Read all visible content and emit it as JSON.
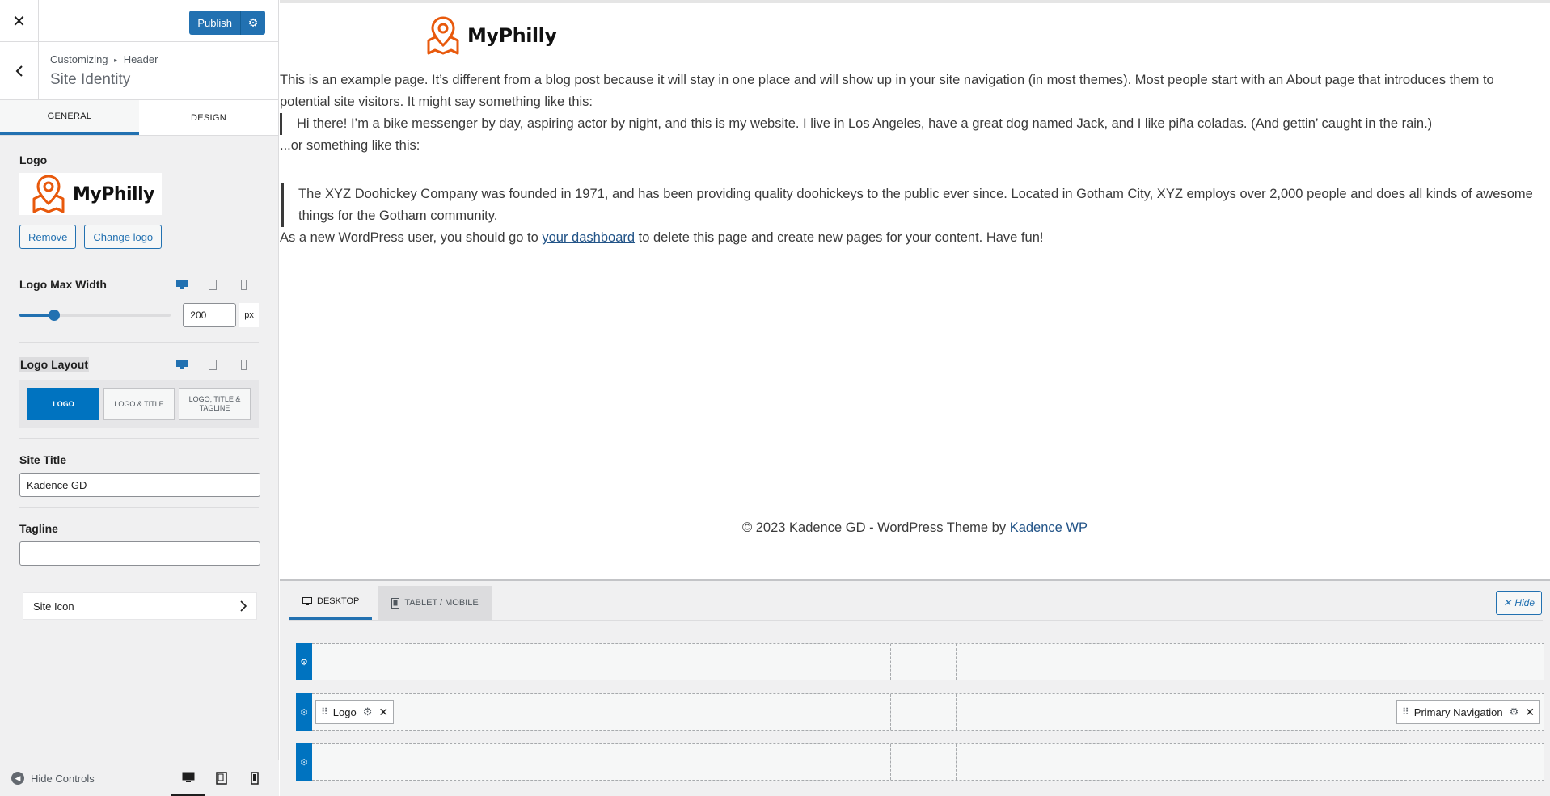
{
  "panel": {
    "publish_label": "Publish",
    "breadcrumb_root": "Customizing",
    "breadcrumb_sep": "▸",
    "breadcrumb_section": "Header",
    "section_title": "Site Identity",
    "tabs": [
      "General",
      "Design"
    ],
    "logo": {
      "label": "Logo",
      "logo_text": "MyPhilly",
      "remove_label": "Remove",
      "change_label": "Change logo"
    },
    "logo_max_width": {
      "label": "Logo Max Width",
      "value": "200",
      "unit": "px",
      "slider_fraction": 0.23
    },
    "logo_layout": {
      "label": "Logo Layout",
      "options": [
        "Logo",
        "Logo & Title",
        "Logo, Title & Tagline"
      ],
      "selected": "Logo"
    },
    "site_title": {
      "label": "Site Title",
      "value": "Kadence GD"
    },
    "tagline": {
      "label": "Tagline",
      "value": ""
    },
    "site_icon_label": "Site Icon",
    "hide_controls_label": "Hide Controls"
  },
  "preview": {
    "logo_text": "MyPhilly",
    "para1": "This is an example page. It’s different from a blog post because it will stay in one place and will show up in your site navigation (in most themes). Most people start with an About page that introduces them to potential site visitors. It might say something like this:",
    "quote1": "Hi there! I’m a bike messenger by day, aspiring actor by night, and this is my website. I live in Los Angeles, have a great dog named Jack, and I like piña coladas. (And gettin’ caught in the rain.)",
    "or_text": "...or something like this:",
    "quote2_line1": "The XYZ Doohickey Company was founded in 1971, and has been providing quality doohickeys to the public ever since. Located in Gotham City, XYZ employs over 2,000 people and does all kinds of awesome",
    "quote2_line2": "things for the Gotham community.",
    "last_before": "As a new WordPress user, you should go to ",
    "last_link": "your dashboard",
    "last_after": " to delete this page and create new pages for your content. Have fun!",
    "footer_before": "© 2023 Kadence GD - WordPress Theme by ",
    "footer_link": "Kadence WP"
  },
  "builder": {
    "tab_desktop": "Desktop",
    "tab_tablet": "Tablet / Mobile",
    "hide_label": "Hide",
    "logo_chip": "Logo",
    "nav_chip": "Primary Navigation"
  },
  "colors": {
    "accent": "#2271b1",
    "builder_blue": "#0073c0",
    "logo_orange": "#e8590c"
  }
}
